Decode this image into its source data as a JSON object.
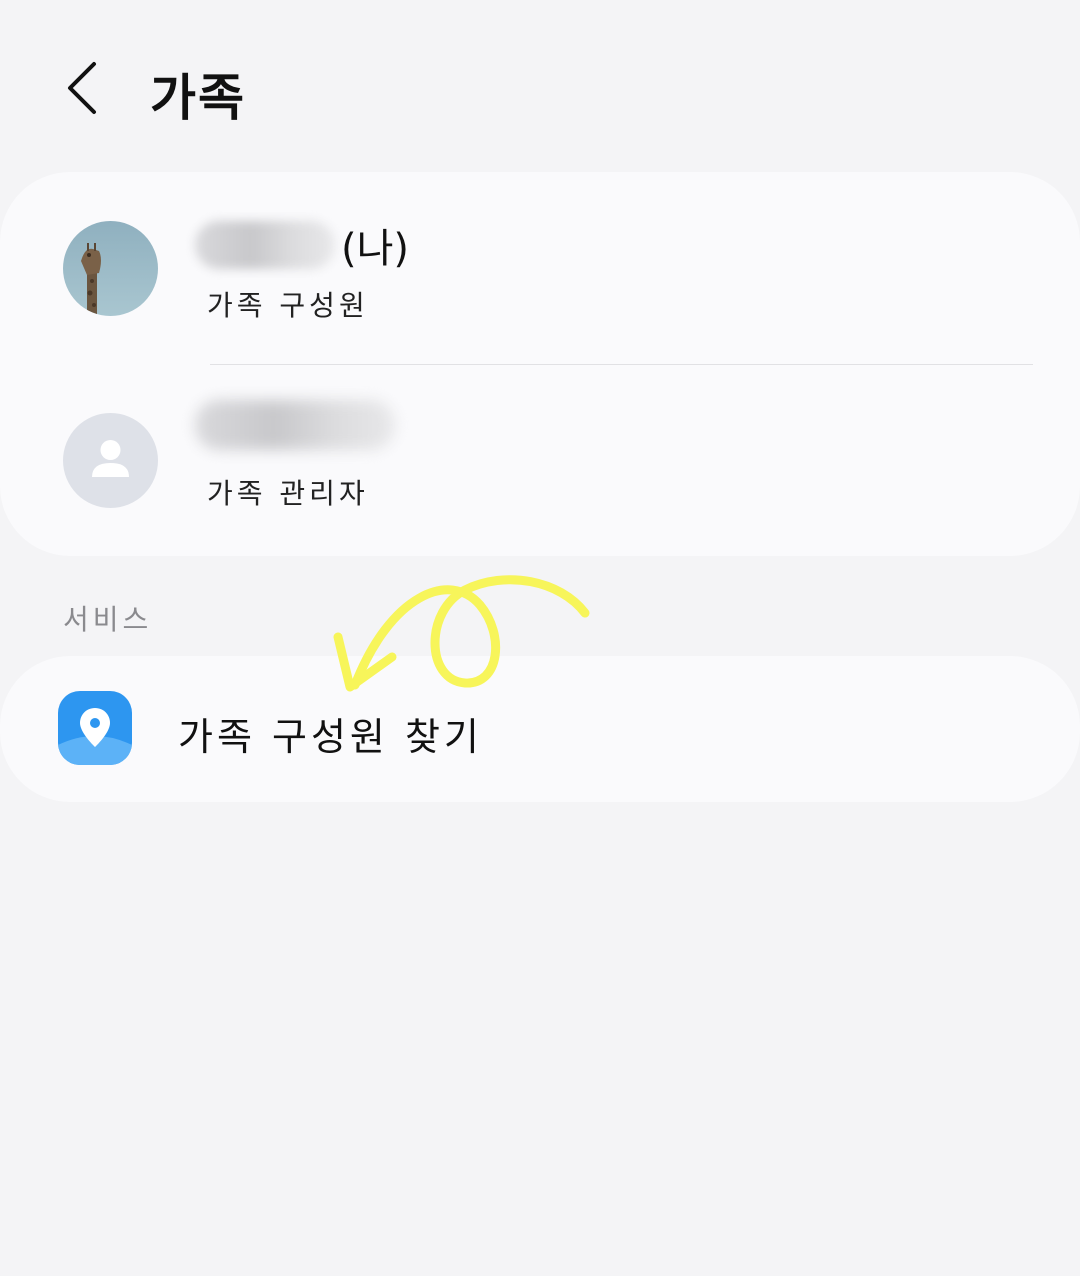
{
  "header": {
    "title": "가족",
    "back_icon": "chevron-left-icon"
  },
  "members": [
    {
      "name_suffix": "(나)",
      "role": "가족 구성원",
      "avatar": "giraffe-photo"
    },
    {
      "name_suffix": "",
      "role": "가족 관리자",
      "avatar": "person-icon"
    }
  ],
  "services": {
    "section_label": "서비스",
    "items": [
      {
        "label": "가족 구성원 찾기",
        "icon": "location-pin-icon"
      }
    ]
  },
  "colors": {
    "background": "#f4f4f6",
    "card": "#fafafc",
    "section_label": "#8a8a8e",
    "service_icon": "#2d96f0",
    "annotation": "#f7f55a"
  }
}
